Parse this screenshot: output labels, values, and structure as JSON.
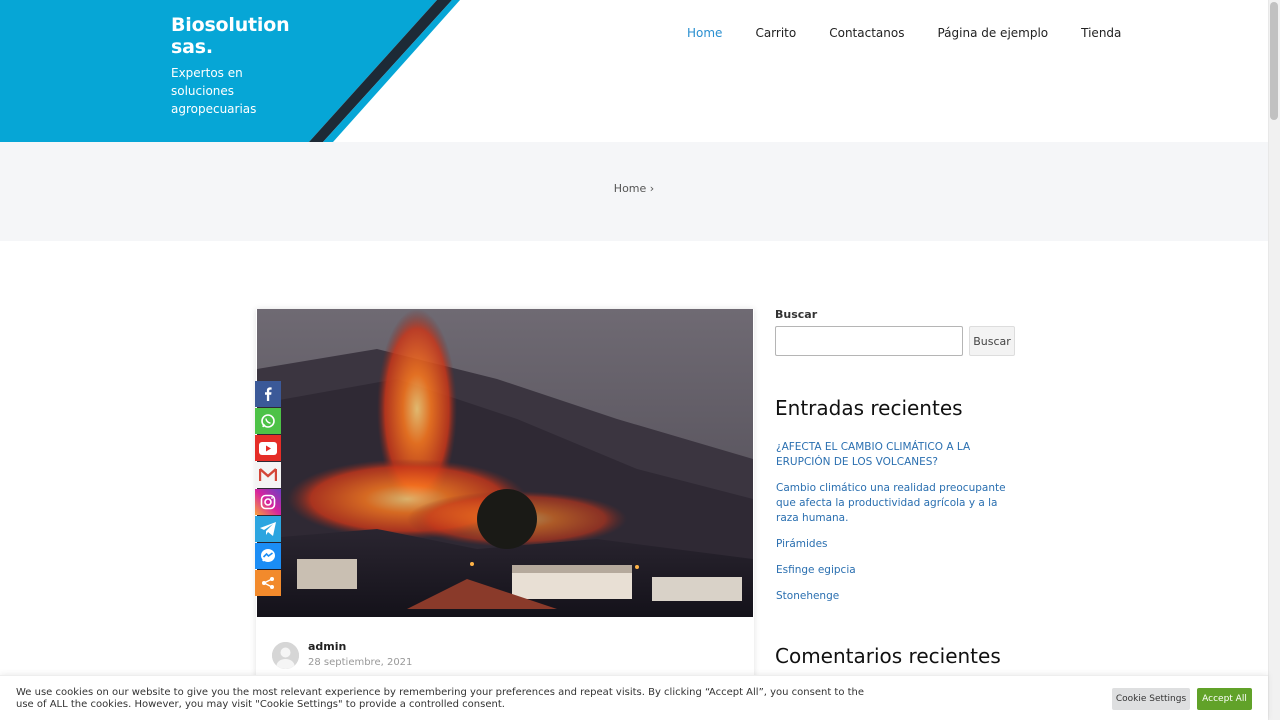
{
  "site": {
    "title": "Biosolution sas.",
    "tagline": "Expertos en soluciones agropecuarias"
  },
  "nav": {
    "items": [
      {
        "label": "Home",
        "active": true
      },
      {
        "label": "Carrito",
        "active": false
      },
      {
        "label": "Contactanos",
        "active": false
      },
      {
        "label": "Página de ejemplo",
        "active": false
      },
      {
        "label": "Tienda",
        "active": false
      }
    ]
  },
  "breadcrumb": {
    "home": "Home",
    "separator": "›"
  },
  "post": {
    "author": "admin",
    "date": "28 septiembre, 2021",
    "image_icon": "volcano-eruption-photo"
  },
  "share": {
    "buttons": [
      {
        "name": "facebook-icon",
        "color": "#3b5998"
      },
      {
        "name": "whatsapp-icon",
        "color": "#4dc247"
      },
      {
        "name": "youtube-icon",
        "color": "#e52d27"
      },
      {
        "name": "gmail-icon",
        "color": "#f4f4f4"
      },
      {
        "name": "instagram-icon",
        "color": "#c13584"
      },
      {
        "name": "telegram-icon",
        "color": "#2ca5e0"
      },
      {
        "name": "messenger-icon",
        "color": "#1b8df5"
      },
      {
        "name": "share-more-icon",
        "color": "#f28a2c"
      }
    ]
  },
  "sidebar": {
    "search_label": "Buscar",
    "search_placeholder": "",
    "search_button": "Buscar",
    "recent_title": "Entradas recientes",
    "recent_posts": [
      "¿AFECTA EL CAMBIO CLIMÁTICO A LA ERUPCIÓN DE LOS VOLCANES?",
      "Cambio climático una realidad preocupante que afecta la productividad agrícola y a la raza humana.",
      "Pirámides",
      "Esfinge egipcia",
      "Stonehenge"
    ],
    "comments_title": "Comentarios recientes"
  },
  "cookie": {
    "text": "We use cookies on our website to give you the most relevant experience by remembering your preferences and repeat visits. By clicking “Accept All”, you consent to the use of ALL the cookies. However, you may visit \"Cookie Settings\" to provide a controlled consent.",
    "settings_label": "Cookie Settings",
    "accept_label": "Accept All"
  },
  "colors": {
    "brand": "#06a6d6",
    "link": "#2a6fb0",
    "nav_active": "#2a8fd0",
    "accept": "#61a229"
  }
}
